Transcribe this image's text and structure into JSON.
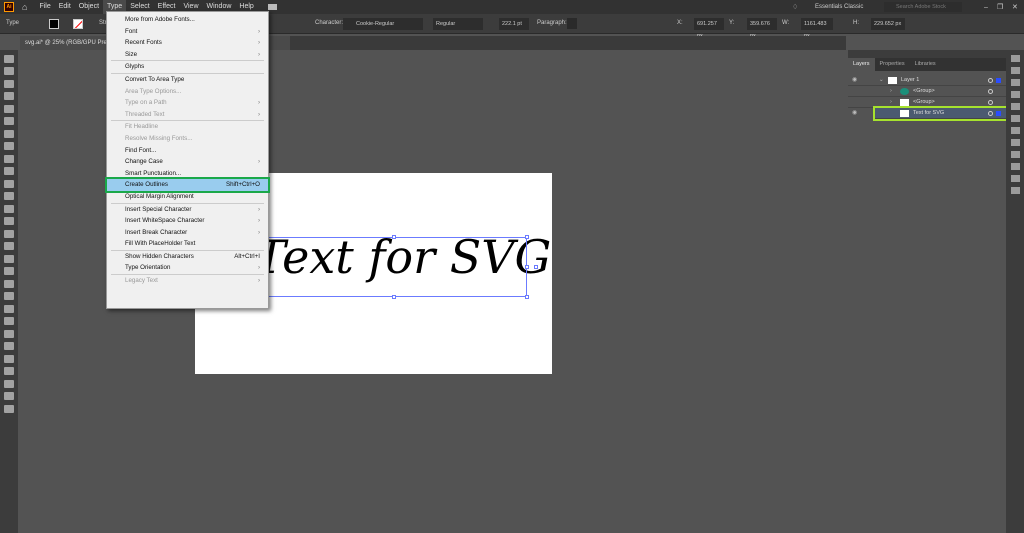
{
  "menubar": {
    "logo": "Ai",
    "items": [
      "File",
      "Edit",
      "Object",
      "Type",
      "Select",
      "Effect",
      "View",
      "Window",
      "Help"
    ],
    "workspace": "Essentials Classic",
    "search_placeholder": "Search Adobe Stock"
  },
  "controlbar": {
    "tool_label": "Type",
    "stroke_label": "Str",
    "character_label": "Character:",
    "font": "Cookie-Regular",
    "style": "Regular",
    "size": "222.1 pt",
    "paragraph_label": "Paragraph:",
    "x_label": "X:",
    "x": "691.257 px",
    "y_label": "Y:",
    "y": "359.676 px",
    "w_label": "W:",
    "w": "1161.483 px",
    "h_label": "H:",
    "h": "229.652 px"
  },
  "document_tab": {
    "title": "svg.ai* @ 25% (RGB/GPU Pre"
  },
  "artboard": {
    "text": "Text for SVG"
  },
  "type_menu": {
    "items": [
      {
        "label": "More from Adobe Fonts...",
        "shortcut": "",
        "submenu": false,
        "disabled": false
      },
      {
        "label": "Font",
        "submenu": true,
        "disabled": false
      },
      {
        "label": "Recent Fonts",
        "submenu": true,
        "disabled": false
      },
      {
        "label": "Size",
        "submenu": true,
        "disabled": false,
        "sep_after": true
      },
      {
        "label": "Glyphs",
        "submenu": false,
        "disabled": false,
        "sep_after": true
      },
      {
        "label": "Convert To Area Type",
        "disabled": false
      },
      {
        "label": "Area Type Options...",
        "disabled": true
      },
      {
        "label": "Type on a Path",
        "submenu": true,
        "disabled": true
      },
      {
        "label": "Threaded Text",
        "submenu": true,
        "disabled": true,
        "sep_after": true
      },
      {
        "label": "Fit Headline",
        "disabled": true
      },
      {
        "label": "Resolve Missing Fonts...",
        "disabled": true
      },
      {
        "label": "Find Font...",
        "disabled": false
      },
      {
        "label": "Change Case",
        "submenu": true,
        "disabled": false
      },
      {
        "label": "Smart Punctuation...",
        "disabled": false
      },
      {
        "label": "Create Outlines",
        "shortcut": "Shift+Ctrl+O",
        "disabled": false,
        "highlight": true
      },
      {
        "label": "Optical Margin Alignment",
        "disabled": false,
        "sep_after": true
      },
      {
        "label": "Insert Special Character",
        "submenu": true,
        "disabled": false
      },
      {
        "label": "Insert WhiteSpace Character",
        "submenu": true,
        "disabled": false
      },
      {
        "label": "Insert Break Character",
        "submenu": true,
        "disabled": false
      },
      {
        "label": "Fill With PlaceHolder Text",
        "disabled": false,
        "sep_after": true
      },
      {
        "label": "Show Hidden Characters",
        "shortcut": "Alt+Ctrl+I",
        "disabled": false
      },
      {
        "label": "Type Orientation",
        "submenu": true,
        "disabled": false,
        "sep_after": true
      },
      {
        "label": "Legacy Text",
        "submenu": true,
        "disabled": true
      }
    ]
  },
  "layers_panel": {
    "tabs": [
      "Layers",
      "Properties",
      "Libraries"
    ],
    "rows": [
      "Layer 1",
      "<Group>",
      "<Group>",
      "Text for SVG"
    ]
  }
}
